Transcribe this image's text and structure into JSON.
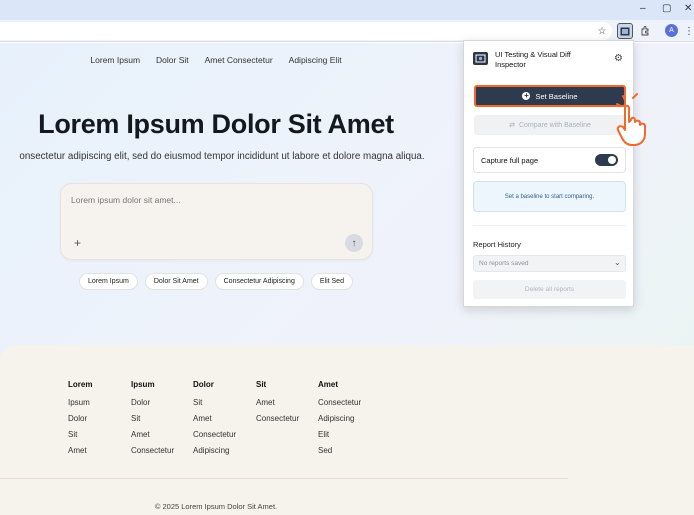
{
  "browser": {
    "window_controls": {
      "minimize": "–",
      "maximize": "▢",
      "close": "✕"
    },
    "avatar_letter": "A"
  },
  "page": {
    "nav": [
      "Lorem Ipsum",
      "Dolor Sit",
      "Amet Consectetur",
      "Adipiscing Elit"
    ],
    "hero_title": "Lorem Ipsum Dolor Sit Amet",
    "hero_subtitle": "onsectetur adipiscing elit, sed do eiusmod tempor incididunt ut labore et dolore magna aliqua.",
    "chat_placeholder": "Lorem ipsum dolor sit amet...",
    "chat_plus": "+",
    "chat_send": "↑",
    "chips": [
      "Lorem Ipsum",
      "Dolor Sit Amet",
      "Consectetur Adipiscing",
      "Elit Sed"
    ]
  },
  "footer": {
    "columns": [
      {
        "heading": "Lorem",
        "links": [
          "Ipsum",
          "Dolor",
          "Sit",
          "Amet"
        ]
      },
      {
        "heading": "Ipsum",
        "links": [
          "Dolor",
          "Sit",
          "Amet",
          "Consectetur"
        ]
      },
      {
        "heading": "Dolor",
        "links": [
          "Sit",
          "Amet",
          "Consectetur",
          "Adipiscing"
        ]
      },
      {
        "heading": "Sit",
        "links": [
          "Amet",
          "Consectetur"
        ]
      },
      {
        "heading": "Amet",
        "links": [
          "Consectetur",
          "Adipiscing",
          "Elit",
          "Sed"
        ]
      }
    ],
    "copyright": "© 2025 Lorem Ipsum Dolor Sit Amet."
  },
  "extension": {
    "title": "UI Testing & Visual Diff Inspector",
    "set_baseline": "Set Baseline",
    "compare": "Compare with Baseline",
    "capture_full_page": "Capture full page",
    "capture_enabled": true,
    "info": "Set a baseline to start comparing.",
    "report_history_title": "Report History",
    "reports_select": "No reports saved",
    "delete_all": "Delete all reports"
  },
  "colors": {
    "accent": "#2e3b4f",
    "highlight": "#ee6b2b"
  }
}
